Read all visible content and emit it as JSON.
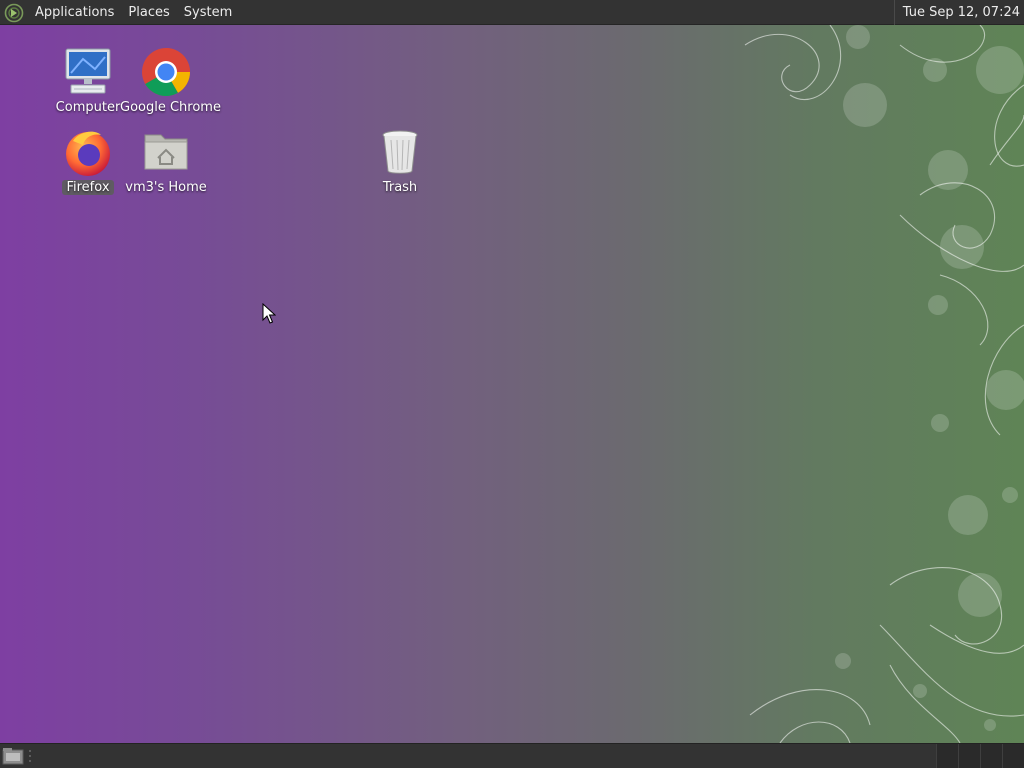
{
  "top_panel": {
    "menus": [
      {
        "label": "Applications"
      },
      {
        "label": "Places"
      },
      {
        "label": "System"
      }
    ],
    "clock": "Tue Sep 12, 07:24"
  },
  "desktop": {
    "icons": [
      {
        "label": "Computer",
        "icon": "computer-icon"
      },
      {
        "label": "Google Chrome",
        "icon": "chrome-icon"
      },
      {
        "label": "Firefox",
        "icon": "firefox-icon",
        "selected": true
      },
      {
        "label": "vm3's Home",
        "icon": "home-folder-icon"
      },
      {
        "label": "Trash",
        "icon": "trash-icon"
      }
    ]
  },
  "bottom_panel": {
    "workspaces": 4
  },
  "colors": {
    "panel": "#333333",
    "desktop_left": "#7e3fa2",
    "desktop_right": "#5f8456"
  }
}
